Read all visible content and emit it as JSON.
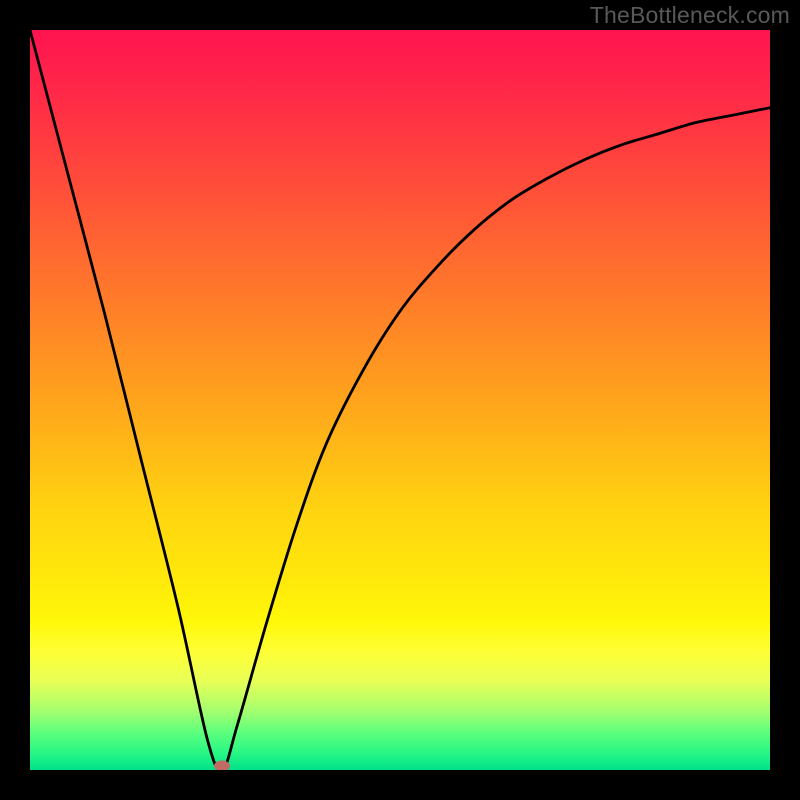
{
  "watermark": "TheBottleneck.com",
  "chart_data": {
    "type": "line",
    "title": "",
    "xlabel": "",
    "ylabel": "",
    "xlim": [
      0,
      100
    ],
    "ylim": [
      0,
      100
    ],
    "grid": false,
    "legend": false,
    "marker": {
      "x": 26,
      "y": 0
    },
    "series": [
      {
        "name": "bottleneck-curve",
        "x": [
          0,
          5,
          10,
          15,
          20,
          24,
          26,
          28,
          32,
          36,
          40,
          45,
          50,
          55,
          60,
          65,
          70,
          75,
          80,
          85,
          90,
          95,
          100
        ],
        "y": [
          100,
          81,
          62,
          42,
          22,
          4,
          0,
          6,
          20,
          33,
          44,
          54,
          62,
          68,
          73,
          77,
          80,
          82.5,
          84.5,
          86,
          87.5,
          88.5,
          89.5
        ]
      }
    ],
    "background_gradient": {
      "top": "#ff1450",
      "mid": "#ffd410",
      "bottom": "#00e08a"
    }
  }
}
